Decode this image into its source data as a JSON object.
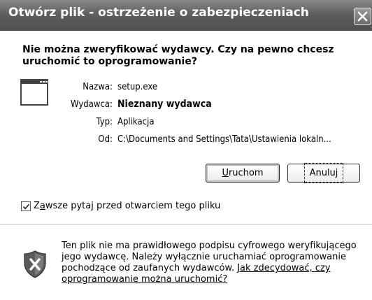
{
  "window": {
    "title": "Otwórz plik - ostrzeżenie o zabezpieczeniach",
    "close_icon": "close-icon"
  },
  "header": {
    "question": "Nie można zweryfikować wydawcy. Czy na pewno chcesz uruchomić to oprogramowanie?"
  },
  "details": {
    "file_icon": "program-window-icon",
    "name_label": "Nazwa:",
    "name_value": "setup.exe",
    "publisher_label": "Wydawca:",
    "publisher_value": "Nieznany wydawca",
    "type_label": "Typ:",
    "type_value": "Aplikacja",
    "from_label": "Od:",
    "from_value": "C:\\Documents and Settings\\Tata\\Ustawienia lokaln..."
  },
  "buttons": {
    "run_pre": "",
    "run_accel": "U",
    "run_post": "ruchom",
    "cancel": "Anuluj"
  },
  "checkbox": {
    "checked": true,
    "label_pre": "Z",
    "label_accel": "a",
    "label_post": "wsze pytaj przed otwarciem tego pliku"
  },
  "warning": {
    "icon": "shield-x-icon",
    "text": "Ten plik nie ma prawidłowego podpisu cyfrowego weryfikującego jego wydawcę. Należy wyłącznie uruchamiać oprogramowanie pochodzące od zaufanych wydawców. ",
    "link": "Jak zdecydować, czy oprogramowanie można uruchomić?"
  }
}
